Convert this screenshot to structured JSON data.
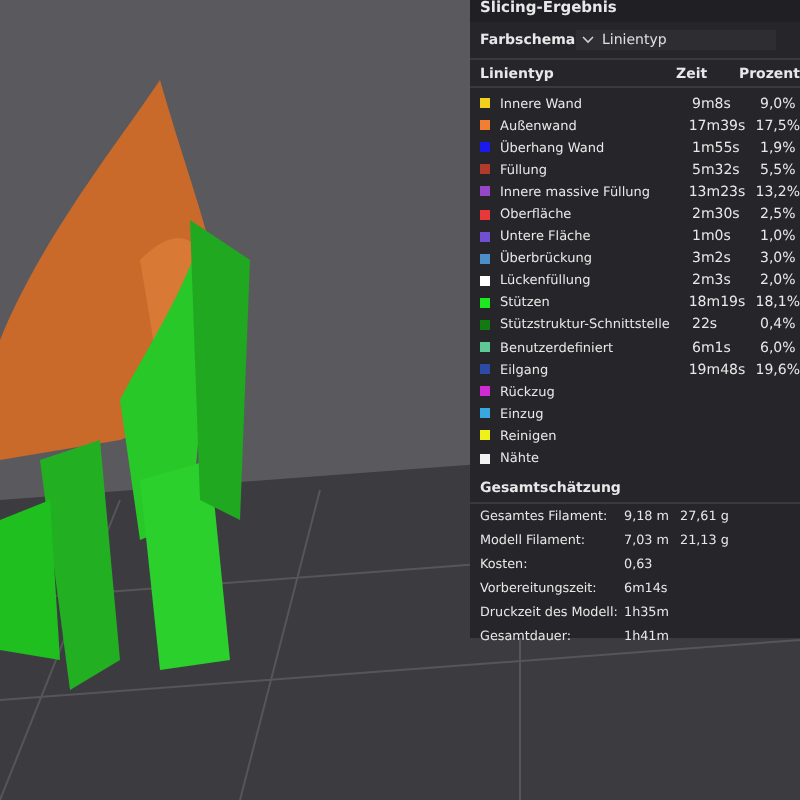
{
  "panel": {
    "title": "Slicing-Ergebnis",
    "color_scheme": {
      "label": "Farbschema",
      "value": "Linientyp"
    },
    "columns": [
      "Linientyp",
      "Zeit",
      "Prozent"
    ],
    "rows": [
      {
        "name": "Innere Wand",
        "color": "#f2d21e",
        "time": "9m8s",
        "percent": "9,0%"
      },
      {
        "name": "Außenwand",
        "color": "#f07f34",
        "time": "17m39s",
        "percent": "17,5%"
      },
      {
        "name": "Überhang Wand",
        "color": "#1a1aee",
        "time": "1m55s",
        "percent": "1,9%"
      },
      {
        "name": "Füllung",
        "color": "#b13a2a",
        "time": "5m32s",
        "percent": "5,5%"
      },
      {
        "name": "Innere massive Füllung",
        "color": "#9646c8",
        "time": "13m23s",
        "percent": "13,2%"
      },
      {
        "name": "Oberfläche",
        "color": "#e8383a",
        "time": "2m30s",
        "percent": "2,5%"
      },
      {
        "name": "Untere Fläche",
        "color": "#7050d0",
        "time": "1m0s",
        "percent": "1,0%"
      },
      {
        "name": "Überbrückung",
        "color": "#4c8ec8",
        "time": "3m2s",
        "percent": "3,0%"
      },
      {
        "name": "Lückenfüllung",
        "color": "#ffffff",
        "time": "2m3s",
        "percent": "2,0%"
      },
      {
        "name": "Stützen",
        "color": "#1ee81e",
        "time": "18m19s",
        "percent": "18,1%"
      },
      {
        "name": "Stützstruktur-Schnittstelle",
        "color": "#117a11",
        "time": "22s",
        "percent": "0,4%"
      },
      {
        "name": "Benutzerdefiniert",
        "color": "#5ec896",
        "time": "6m1s",
        "percent": "6,0%"
      },
      {
        "name": "Eilgang",
        "color": "#2c4aa6",
        "time": "19m48s",
        "percent": "19,6%"
      },
      {
        "name": "Rückzug",
        "color": "#d22ad2",
        "time": "",
        "percent": ""
      },
      {
        "name": "Einzug",
        "color": "#3aa8e0",
        "time": "",
        "percent": ""
      },
      {
        "name": "Reinigen",
        "color": "#f0f01a",
        "time": "",
        "percent": ""
      },
      {
        "name": "Nähte",
        "color": "#f2f2f2",
        "time": "",
        "percent": ""
      }
    ],
    "estimate": {
      "title": "Gesamtschätzung",
      "rows": [
        {
          "label": "Gesamtes Filament:",
          "value": "9,18 m",
          "extra": "27,61 g"
        },
        {
          "label": "Modell Filament:",
          "value": "7,03 m",
          "extra": "21,13 g"
        },
        {
          "label": "Kosten:",
          "value": "0,63"
        },
        {
          "label": "Vorbereitungszeit:",
          "value": "6m14s"
        },
        {
          "label": "Druckzeit des Modell:",
          "value": "1h35m"
        },
        {
          "label": "Gesamtdauer:",
          "value": "1h41m"
        }
      ]
    }
  }
}
